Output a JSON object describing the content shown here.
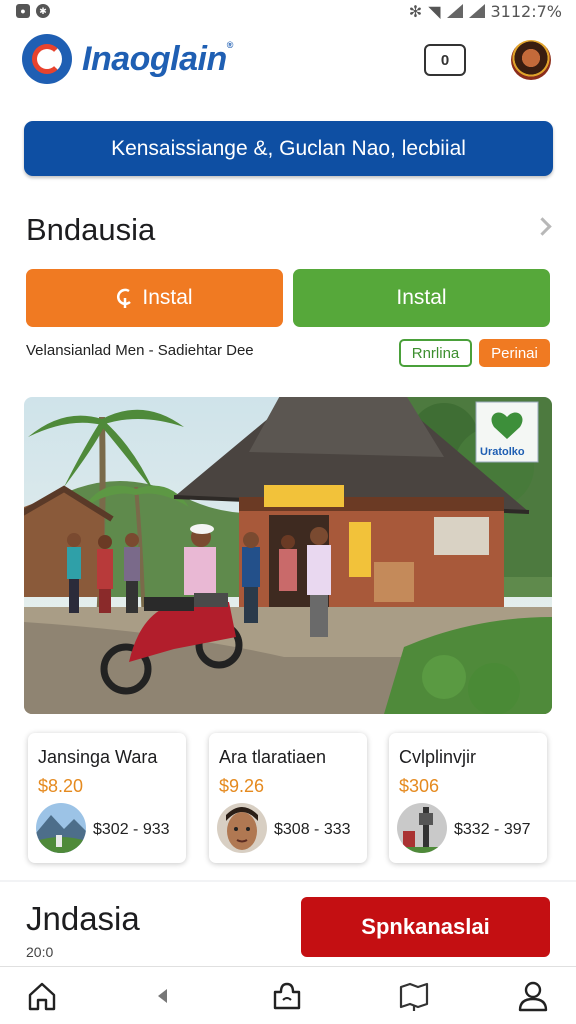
{
  "status_bar": {
    "left_icons": [
      "notification-icon",
      "settings-icon"
    ],
    "right_text": "3112:7%"
  },
  "header": {
    "brand": "Inaoglain",
    "brand_mark": "®",
    "badge_value": "0",
    "banner_text": "Kensaissiange &, Guclan Nao, lecbiial"
  },
  "section": {
    "title": "Bndausia",
    "primary_button": "Instal",
    "secondary_button": "Instal",
    "subline": "Velansianlad Men - Sadiehtar Dee",
    "tag_outline": "Rnrlina",
    "tag_filled": "Perinai",
    "hero_sign_text": "Uratolko"
  },
  "items": [
    {
      "title": "Jansinga Wara",
      "price": "$8.20",
      "range": "$302 - 933",
      "thumb": "mountain-landscape"
    },
    {
      "title": "Ara tlaratiaen",
      "price": "$9.26",
      "range": "$308 - 333",
      "thumb": "person-portrait"
    },
    {
      "title": "Cvlplinvjir",
      "price": "$306",
      "range": "$332 - 397",
      "thumb": "street-scene"
    }
  ],
  "bottom": {
    "title": "Jndasia",
    "subtitle": "20:0",
    "cta": "Spnkanaslai"
  },
  "nav": [
    "home-icon",
    "back-icon",
    "puzzle-icon",
    "map-book-icon",
    "profile-icon"
  ],
  "colors": {
    "brand_blue": "#1f5fb3",
    "banner_blue": "#0e4fa3",
    "orange": "#f07a22",
    "green": "#56a83a",
    "red": "#c40f12",
    "price_orange": "#e58a1f"
  }
}
